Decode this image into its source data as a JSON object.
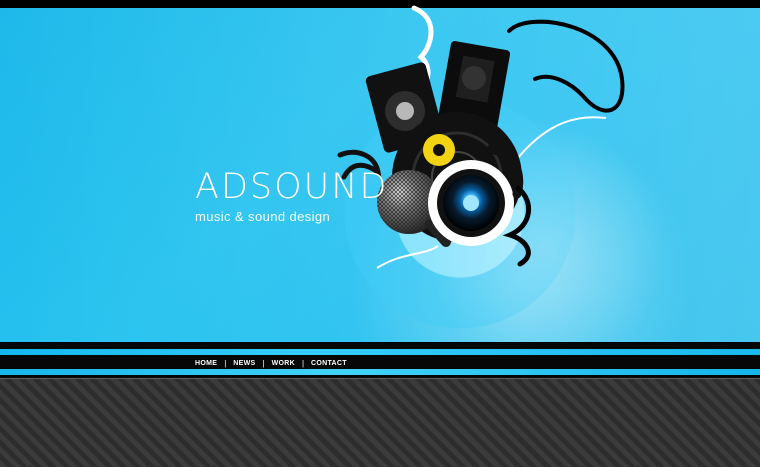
{
  "brand": {
    "title": "ADSOUND",
    "subtitle": "music & sound design"
  },
  "nav": {
    "items": [
      {
        "label": "HOME"
      },
      {
        "label": "NEWS"
      },
      {
        "label": "WORK"
      },
      {
        "label": "CONTACT"
      }
    ],
    "separator": "|"
  },
  "colors": {
    "hero_blue": "#20bff0",
    "stripe_blue": "#35cdf7",
    "black": "#000000",
    "pattern_dark": "#2d2d2d",
    "pattern_light": "#3b3b3b",
    "brand_white": "#ffffff",
    "accent_yellow": "#f3d414"
  },
  "icons": {
    "speaker_left": "speaker-icon",
    "speaker_right": "speaker-icon",
    "microphone": "microphone-icon",
    "main_speaker": "speaker-cone-icon",
    "vinyl": "vinyl-record-icon",
    "headphones": "headphones-icon"
  }
}
